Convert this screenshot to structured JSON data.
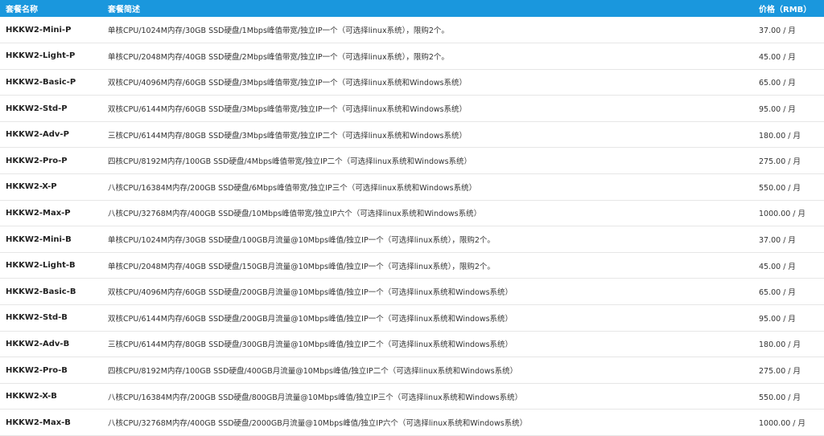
{
  "colors": {
    "header_bg": "#1a97dd",
    "header_text": "#ffffff",
    "row_divider": "#e6e6e6",
    "body_text": "#333333"
  },
  "table": {
    "headers": {
      "name": "套餐名称",
      "description": "套餐简述",
      "price": "价格（RMB）"
    },
    "rows": [
      {
        "name": "HKKW2-Mini-P",
        "description": "单核CPU/1024M内存/30GB SSD硬盘/1Mbps峰值带宽/独立IP一个（可选择linux系统），限购2个。",
        "price": "37.00 / 月"
      },
      {
        "name": "HKKW2-Light-P",
        "description": "单核CPU/2048M内存/40GB SSD硬盘/2Mbps峰值带宽/独立IP一个（可选择linux系统），限购2个。",
        "price": "45.00 / 月"
      },
      {
        "name": "HKKW2-Basic-P",
        "description": "双核CPU/4096M内存/60GB SSD硬盘/3Mbps峰值带宽/独立IP一个（可选择linux系统和Windows系统）",
        "price": "65.00 / 月"
      },
      {
        "name": "HKKW2-Std-P",
        "description": "双核CPU/6144M内存/60GB SSD硬盘/3Mbps峰值带宽/独立IP一个（可选择linux系统和Windows系统）",
        "price": "95.00 / 月"
      },
      {
        "name": "HKKW2-Adv-P",
        "description": "三核CPU/6144M内存/80GB SSD硬盘/3Mbps峰值带宽/独立IP二个（可选择linux系统和Windows系统）",
        "price": "180.00 / 月"
      },
      {
        "name": "HKKW2-Pro-P",
        "description": "四核CPU/8192M内存/100GB SSD硬盘/4Mbps峰值带宽/独立IP二个（可选择linux系统和Windows系统）",
        "price": "275.00 / 月"
      },
      {
        "name": "HKKW2-X-P",
        "description": "八核CPU/16384M内存/200GB SSD硬盘/6Mbps峰值带宽/独立IP三个（可选择linux系统和Windows系统）",
        "price": "550.00 / 月"
      },
      {
        "name": "HKKW2-Max-P",
        "description": "八核CPU/32768M内存/400GB SSD硬盘/10Mbps峰值带宽/独立IP六个（可选择linux系统和Windows系统）",
        "price": "1000.00 / 月"
      },
      {
        "name": "HKKW2-Mini-B",
        "description": "单核CPU/1024M内存/30GB SSD硬盘/100GB月流量@10Mbps峰值/独立IP一个（可选择linux系统），限购2个。",
        "price": "37.00 / 月"
      },
      {
        "name": "HKKW2-Light-B",
        "description": "单核CPU/2048M内存/40GB SSD硬盘/150GB月流量@10Mbps峰值/独立IP一个（可选择linux系统），限购2个。",
        "price": "45.00 / 月"
      },
      {
        "name": "HKKW2-Basic-B",
        "description": "双核CPU/4096M内存/60GB SSD硬盘/200GB月流量@10Mbps峰值/独立IP一个（可选择linux系统和Windows系统）",
        "price": "65.00 / 月"
      },
      {
        "name": "HKKW2-Std-B",
        "description": "双核CPU/6144M内存/60GB SSD硬盘/200GB月流量@10Mbps峰值/独立IP一个（可选择linux系统和Windows系统）",
        "price": "95.00 / 月"
      },
      {
        "name": "HKKW2-Adv-B",
        "description": "三核CPU/6144M内存/80GB SSD硬盘/300GB月流量@10Mbps峰值/独立IP二个（可选择linux系统和Windows系统）",
        "price": "180.00 / 月"
      },
      {
        "name": "HKKW2-Pro-B",
        "description": "四核CPU/8192M内存/100GB SSD硬盘/400GB月流量@10Mbps峰值/独立IP二个（可选择linux系统和Windows系统）",
        "price": "275.00 / 月"
      },
      {
        "name": "HKKW2-X-B",
        "description": "八核CPU/16384M内存/200GB SSD硬盘/800GB月流量@10Mbps峰值/独立IP三个（可选择linux系统和Windows系统）",
        "price": "550.00 / 月"
      },
      {
        "name": "HKKW2-Max-B",
        "description": "八核CPU/32768M内存/400GB SSD硬盘/2000GB月流量@10Mbps峰值/独立IP六个（可选择linux系统和Windows系统）",
        "price": "1000.00 / 月"
      }
    ]
  }
}
